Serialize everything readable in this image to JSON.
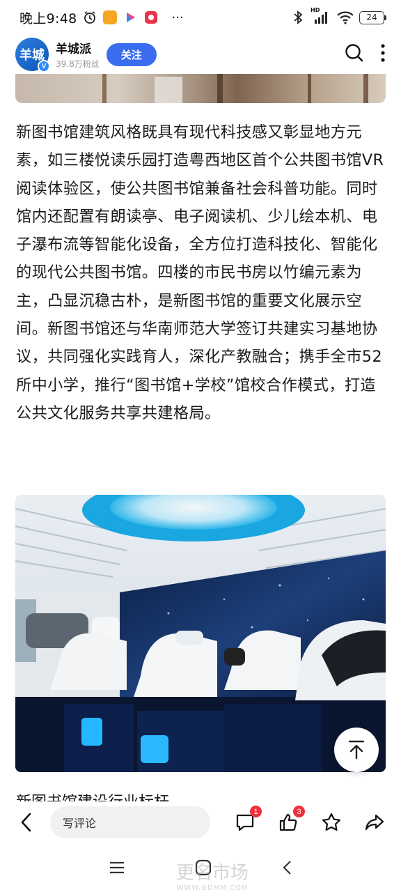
{
  "status_bar": {
    "time": "晚上9:48",
    "more": "···",
    "network": "HD",
    "battery": "24"
  },
  "header": {
    "account_name": "羊城派",
    "avatar_text": "羊城",
    "fans": "39.8万粉丝",
    "follow_label": "关注",
    "icons": [
      "search-icon",
      "more-vertical-icon"
    ]
  },
  "article": {
    "paragraph": "新图书馆建筑风格既具有现代科技感又彰显地方元素，如三楼悦读乐园打造粤西地区首个公共图书馆VR阅读体验区，使公共图书馆兼备社会科普功能。同时馆内还配置有朗读亭、电子阅读机、少儿绘本机、电子瀑布流等智能化设备，全方位打造科技化、智能化的现代公共图书馆。四楼的市民书房以竹编元素为主，凸显沉稳古朴，是新图书馆的重要文化展示空间。新图书馆还与华南师范大学签订共建实习基地协议，共同强化实践育人，深化产教融合；携手全市52所中小学，推行“图书馆+学校”馆校合作模式，打造公共文化服务共享共建格局。",
    "next_paragraph_partial": "新图书馆建设行业标杆..."
  },
  "bottom_bar": {
    "comment_placeholder": "写评论",
    "comment_badge": "1",
    "like_badge": "3",
    "icons": [
      "back-icon",
      "comment-icon",
      "like-icon",
      "star-icon",
      "share-icon"
    ]
  },
  "nav_bar": {
    "icons": [
      "menu-icon",
      "home-icon",
      "back-triangle-icon"
    ]
  },
  "watermark": {
    "text": "更名市场",
    "url": "WWW.GDMM.COM"
  },
  "colors": {
    "accent": "#3a6df0",
    "badge": "#f0303a",
    "text": "#1b1b1b"
  }
}
